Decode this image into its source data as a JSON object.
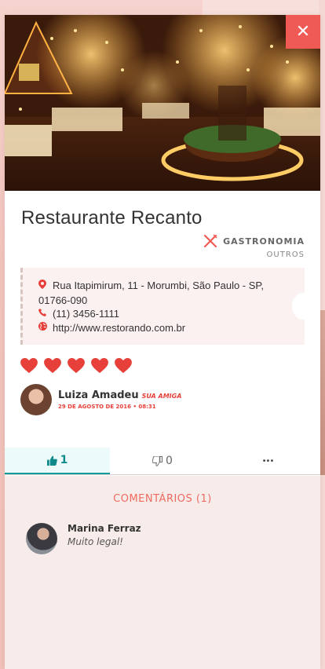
{
  "venue": {
    "title": "Restaurante Recanto",
    "category": "GASTRONOMIA",
    "subcategory": "OUTROS"
  },
  "info": {
    "address_line1": "Rua Itapimirum, 11 - Morumbi, São Paulo - SP,",
    "address_line2": "01766-090",
    "phone": "(11) 3456-1111",
    "website": "http://www.restorando.com.br"
  },
  "rating": {
    "hearts": 5,
    "max": 5,
    "color": "#e7403a"
  },
  "author": {
    "name": "Luiza Amadeu",
    "tag": "SUA AMIGA",
    "date": "29 DE AGOSTO DE 2016 • 08:31"
  },
  "actions": {
    "like_count": "1",
    "dislike_count": "0",
    "more_label": "•••"
  },
  "comments": {
    "title": "COMENTÁRIOS (1)",
    "items": [
      {
        "name": "Marina Ferraz",
        "text": "Muito legal!"
      }
    ]
  },
  "close_label": "✕",
  "colors": {
    "accent": "#f05a55",
    "active_tab": "#0f8a8a",
    "comments_bg": "#f8ecea"
  },
  "icons": {
    "close": "close-icon",
    "category": "fork-knife-icon",
    "address": "map-pin-icon",
    "phone": "phone-icon",
    "website": "globe-icon",
    "like": "thumbs-up-icon",
    "dislike": "thumbs-down-icon",
    "more": "ellipsis-icon",
    "heart": "heart-icon"
  }
}
